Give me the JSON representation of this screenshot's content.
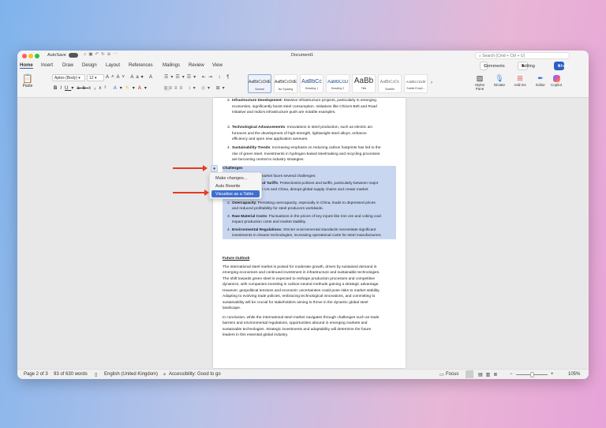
{
  "window": {
    "title": "Document1",
    "autosave_label": "AutoSave",
    "search_placeholder": "Search (Cmd + Ctrl + U)"
  },
  "tabs": [
    "Home",
    "Insert",
    "Draw",
    "Design",
    "Layout",
    "References",
    "Mailings",
    "Review",
    "View"
  ],
  "ribbon": {
    "paste": "Paste",
    "font": "Aptos (Body)",
    "size": "12",
    "comments": "Comments",
    "editing": "Editing",
    "share": "Share",
    "styles": [
      {
        "preview": "AaBbCcDdE",
        "label": "Normal"
      },
      {
        "preview": "AaBbCcDdE",
        "label": "No Spacing"
      },
      {
        "preview": "AaBbCc",
        "label": "Heading 1"
      },
      {
        "preview": "AaBbCcD",
        "label": "Heading 2"
      },
      {
        "preview": "AaBb",
        "label": "Title"
      },
      {
        "preview": "AaBbCcDc",
        "label": "Subtitle"
      },
      {
        "preview": "AaBbCcDdE",
        "label": "Subtle Emph..."
      }
    ],
    "styles_pane": "Styles Pane",
    "dictate": "Dictate",
    "addins": "Add-ins",
    "editor": "Editor",
    "copilot": "Copilot"
  },
  "document": {
    "list1": [
      {
        "num": "2.",
        "bold": "Infrastructure Development:",
        "text": " Massive infrastructure projects, particularly in emerging economies, significantly boost steel consumption. Initiatives like China's Belt and Road Initiative and India's infrastructure push are notable examples."
      },
      {
        "num": "3.",
        "bold": "Technological Advancements",
        "text": ": Innovations in steel production, such as electric arc furnaces and the development of high-strength, lightweight steel alloys, enhance efficiency and open new application avenues."
      },
      {
        "num": "4.",
        "bold": "Sustainability Trends",
        "text": ": Increasing emphasis on reducing carbon footprints has led to the rise of green steel. Investments in hydrogen-based steelmaking and recycling processes are becoming central to industry strategies."
      }
    ],
    "challenges_heading": "Challenges",
    "challenges_intro": "The international steel market faces several challenges:",
    "list2": [
      {
        "num": "1.",
        "bold": "Trade Barriers and Tariffs",
        "text": ": Protectionist policies and tariffs, particularly between major economies like the US and China, disrupt global supply chains and create market volatility."
      },
      {
        "num": "2.",
        "bold": "Overcapacity",
        "text": ": Persisting overcapacity, especially in China, leads to depressed prices and reduced profitability for steel producers worldwide."
      },
      {
        "num": "3.",
        "bold": "Raw Material Costs",
        "text": ": Fluctuations in the prices of key inputs like iron ore and coking coal impact production costs and market stability."
      },
      {
        "num": "4.",
        "bold": "Environmental Regulations:",
        "text": " Stricter environmental standards necessitate significant investments in cleaner technologies, increasing operational costs for steel manufacturers."
      }
    ],
    "outlook_heading": "Future Outlook",
    "outlook_p1": "The international steel market is poised for moderate growth, driven by sustained demand in emerging economies and continued investment in infrastructure and sustainable technologies. The shift towards green steel is expected to reshape production processes and competitive dynamics, with companies investing in carbon-neutral methods gaining a strategic advantage. However, geopolitical tensions and economic uncertainties could pose risks to market stability. Adapting to evolving trade policies, embracing technological innovations, and committing to sustainability will be crucial for stakeholders aiming to thrive in the dynamic global steel landscape.",
    "outlook_p2": "In conclusion, while the international steel market navigates through challenges such as trade barriers and environmental regulations, opportunities abound in emerging markets and sustainable technologies. Strategic investments and adaptability will determine the future leaders in this essential global industry."
  },
  "copilot_menu": [
    "Make changes...",
    "Auto Rewrite",
    "Visualise as a Table"
  ],
  "status": {
    "page": "Page 2 of 3",
    "words": "93 of 630 words",
    "language": "English (United Kingdom)",
    "accessibility": "Accessibility: Good to go",
    "focus": "Focus",
    "zoom": "105%"
  },
  "colors": {
    "accent": "#2b5fc5",
    "selection": "#c9d6f0",
    "arrow": "#e53a22"
  }
}
